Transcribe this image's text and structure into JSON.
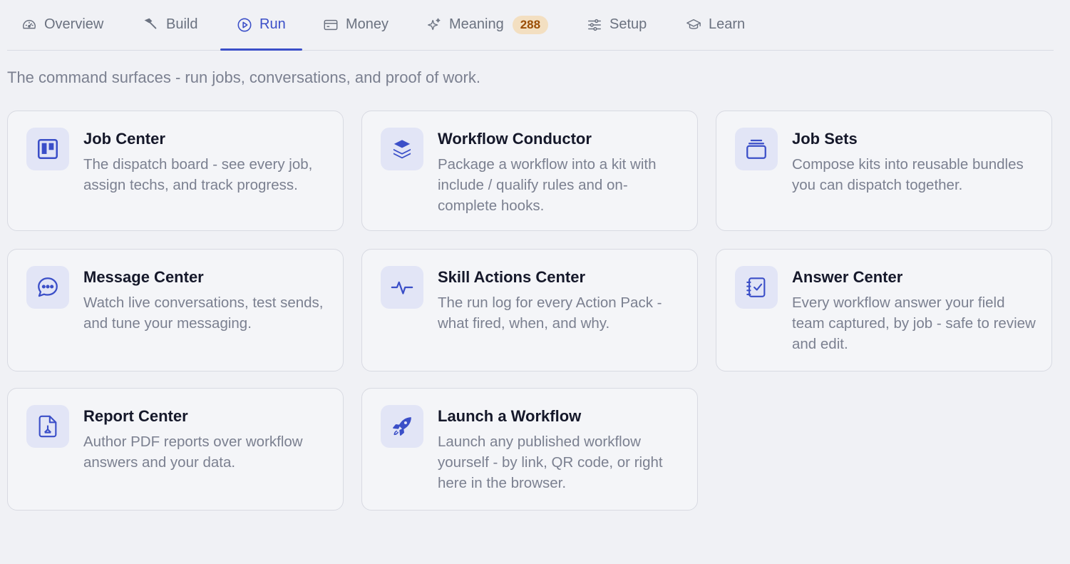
{
  "tabs": [
    {
      "label": "Overview",
      "icon": "gauge-icon"
    },
    {
      "label": "Build",
      "icon": "hammer-icon"
    },
    {
      "label": "Run",
      "icon": "play-circle-icon",
      "active": true
    },
    {
      "label": "Money",
      "icon": "credit-card-icon"
    },
    {
      "label": "Meaning",
      "icon": "sparkles-icon",
      "badge": "288"
    },
    {
      "label": "Setup",
      "icon": "sliders-icon"
    },
    {
      "label": "Learn",
      "icon": "graduation-cap-icon"
    }
  ],
  "subtitle": "The command surfaces - run jobs, conversations, and proof of work.",
  "cards": [
    {
      "title": "Job Center",
      "description": "The dispatch board - see every job, assign techs, and track progress.",
      "icon": "kanban-icon"
    },
    {
      "title": "Workflow Conductor",
      "description": "Package a workflow into a kit with include / qualify rules and on-complete hooks.",
      "icon": "layers-icon"
    },
    {
      "title": "Job Sets",
      "description": "Compose kits into reusable bundles you can dispatch together.",
      "icon": "stack-icon"
    },
    {
      "title": "Message Center",
      "description": "Watch live conversations, test sends, and tune your messaging.",
      "icon": "chat-bubble-icon"
    },
    {
      "title": "Skill Actions Center",
      "description": "The run log for every Action Pack - what fired, when, and why.",
      "icon": "activity-icon"
    },
    {
      "title": "Answer Center",
      "description": "Every workflow answer your field team captured, by job - safe to review and edit.",
      "icon": "notebook-check-icon"
    },
    {
      "title": "Report Center",
      "description": "Author PDF reports over workflow answers and your data.",
      "icon": "pdf-file-icon"
    },
    {
      "title": "Launch a Workflow",
      "description": "Launch any published workflow yourself - by link, QR code, or right here in the browser.",
      "icon": "rocket-icon"
    }
  ],
  "colors": {
    "accent": "#3b4fc8",
    "badge_bg": "#f3dfc1",
    "badge_text": "#9a4d06",
    "icon_tile": "#e2e5f6"
  }
}
